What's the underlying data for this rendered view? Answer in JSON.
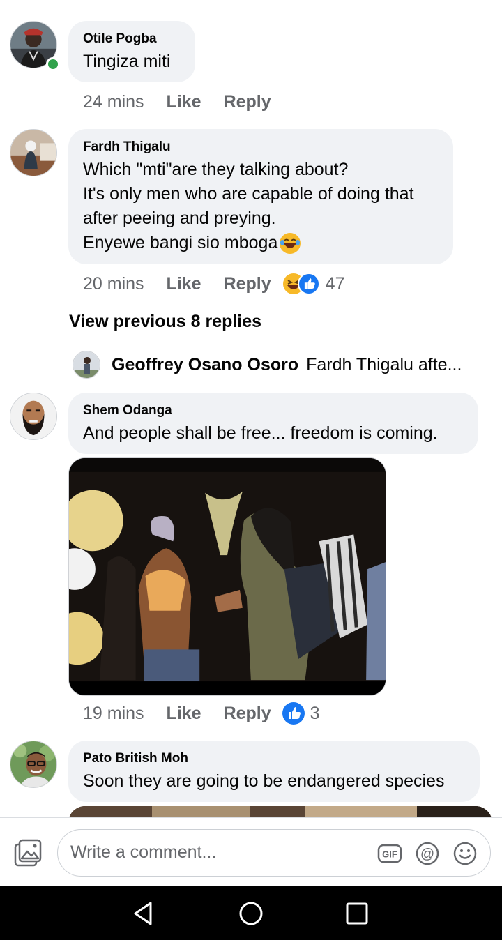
{
  "comments": [
    {
      "author": "Otile Pogba",
      "lines": [
        "Tingiza miti"
      ],
      "time": "24 mins",
      "like_label": "Like",
      "reply_label": "Reply",
      "online": true
    },
    {
      "author": "Fardh Thigalu",
      "lines": [
        "Which \"mti\"are they talking about?",
        "It's only men who are capable of doing that",
        "after peeing and preying.",
        "Enyewe bangi sio mboga"
      ],
      "time": "20 mins",
      "like_label": "Like",
      "reply_label": "Reply",
      "reactions": [
        "laugh",
        "like"
      ],
      "reaction_count": "47",
      "view_previous": "View previous 8 replies",
      "latest_reply": {
        "author": "Geoffrey Osano Osoro",
        "preview": "Fardh Thigalu afte..."
      }
    },
    {
      "author": "Shem Odanga",
      "lines": [
        "And people shall be free... freedom is coming."
      ],
      "time": "19 mins",
      "like_label": "Like",
      "reply_label": "Reply",
      "reactions": [
        "like"
      ],
      "reaction_count": "3",
      "has_photo": true
    },
    {
      "author": "Pato British Moh",
      "lines": [
        "Soon they are going to be endangered species"
      ],
      "has_photo": true
    }
  ],
  "composer": {
    "placeholder": "Write a comment...",
    "icons": [
      "photo-icon",
      "gif-icon",
      "mention-icon",
      "emoji-icon"
    ]
  },
  "navigation": {
    "icons": [
      "back-icon",
      "home-icon",
      "recents-icon"
    ]
  },
  "colors": {
    "bubble": "#f0f2f5",
    "meta_text": "#65676b",
    "like_blue": "#1877f2",
    "online_green": "#31a24c"
  }
}
